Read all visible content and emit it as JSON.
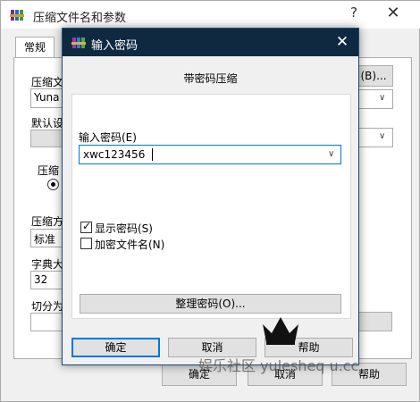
{
  "background_window": {
    "title": "压缩文件名和参数",
    "help_glyph": "?",
    "close_glyph": "✕",
    "tab_general": "常规",
    "archive_name_label": "压缩文",
    "archive_name_value": "Yuna T",
    "browse_button": "(B)...",
    "default_profile_label": "默认设",
    "format_label": "压缩",
    "method_label": "压缩方",
    "method_value": "标准",
    "dict_label": "字典大",
    "dict_value": "32",
    "split_label": "切分为",
    "ok_button": "确定",
    "cancel_button": "取消",
    "help_button": "帮助"
  },
  "dialog": {
    "title": "输入密码",
    "close_glyph": "✕",
    "heading": "带密码压缩",
    "password_label": "输入密码(E)",
    "password_value": "xwc123456",
    "show_password_label": "显示密码(S)",
    "show_password_checked": true,
    "encrypt_filenames_label": "加密文件名(N)",
    "encrypt_filenames_checked": false,
    "organize_button": "整理密码(O)...",
    "ok_button": "确定",
    "cancel_button": "取消",
    "help_button": "帮助"
  },
  "watermark": "娱乐社区 yulesheq u.cc",
  "colors": {
    "dialog_titlebar": "#0f2a40",
    "focus_accent": "#0078d7"
  },
  "icons": {
    "app": "winrar-books-icon",
    "crown": "crown-icon"
  }
}
